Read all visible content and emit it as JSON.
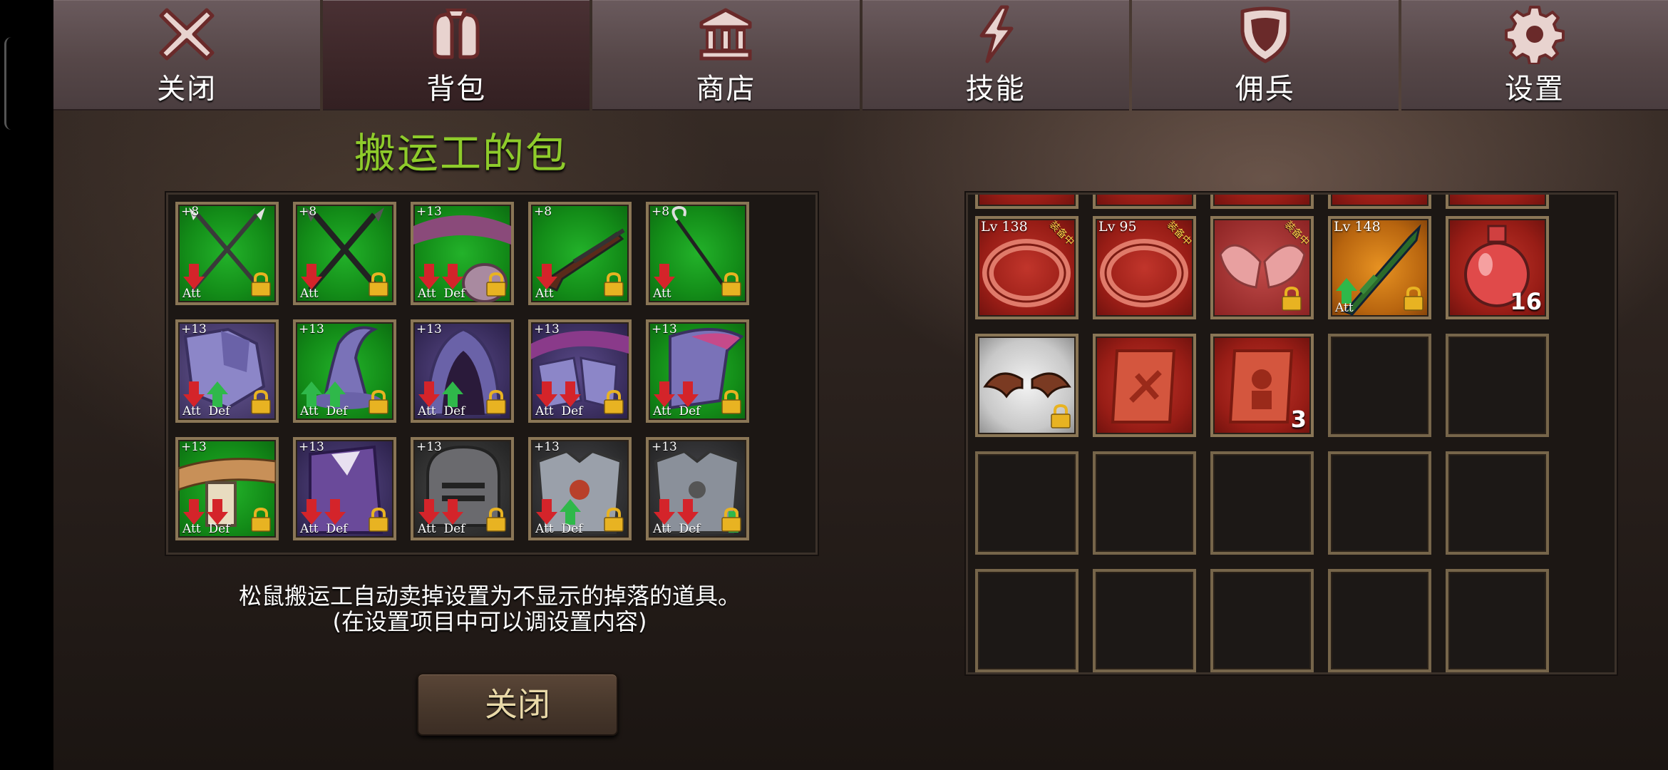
{
  "tabs": [
    {
      "label": "关闭",
      "icon": "close-x-icon"
    },
    {
      "label": "背包",
      "icon": "backpack-icon",
      "active": true
    },
    {
      "label": "商店",
      "icon": "shop-building-icon"
    },
    {
      "label": "技能",
      "icon": "lightning-icon"
    },
    {
      "label": "佣兵",
      "icon": "shield-icon"
    },
    {
      "label": "设置",
      "icon": "gear-icon"
    }
  ],
  "bag": {
    "title": "搬运工的包",
    "items": [
      {
        "level": "+8",
        "stats": "Att",
        "item": "crossed-spears"
      },
      {
        "level": "+8",
        "stats": "Att",
        "item": "crossed-dark-spears"
      },
      {
        "level": "+13",
        "stats": "Att  Def",
        "item": "purple-belt"
      },
      {
        "level": "+8",
        "stats": "Att",
        "item": "rifle"
      },
      {
        "level": "+8",
        "stats": "Att",
        "item": "hook-staff"
      },
      {
        "level": "+13",
        "stats": "Att  Def",
        "item": "purple-armor"
      },
      {
        "level": "+13",
        "stats": "Att  Def",
        "item": "purple-wizard-hat"
      },
      {
        "level": "+13",
        "stats": "Att  Def",
        "item": "purple-hood"
      },
      {
        "level": "+13",
        "stats": "Att  Def",
        "item": "purple-gloves"
      },
      {
        "level": "+13",
        "stats": "Att  Def",
        "item": "purple-boots"
      },
      {
        "level": "+13",
        "stats": "Att  Def",
        "item": "brown-belt"
      },
      {
        "level": "+13",
        "stats": "Att  Def",
        "item": "purple-cloak"
      },
      {
        "level": "+13",
        "stats": "Att  Def",
        "item": "steel-helmet"
      },
      {
        "level": "+13",
        "stats": "Att  Def",
        "item": "steel-armor"
      },
      {
        "level": "+13",
        "stats": "Att  Def",
        "item": "steel-armor-2"
      }
    ]
  },
  "inventory": {
    "items": [
      {
        "lv": "Lv 138",
        "ribbon": "装备中",
        "item": "red-ring"
      },
      {
        "lv": "Lv 95",
        "ribbon": "装备中",
        "item": "red-ring-2"
      },
      {
        "lv": "",
        "ribbon": "装备中",
        "item": "angel-wings"
      },
      {
        "lv": "Lv 148",
        "stats": "Att",
        "item": "green-sword"
      },
      {
        "count": "16",
        "item": "red-potion"
      },
      {
        "item": "bat-wings"
      },
      {
        "item": "red-scroll"
      },
      {
        "count": "3",
        "item": "red-scroll-2"
      }
    ]
  },
  "message": {
    "line1": "松鼠搬运工自动卖掉设置为不显示的掉落的道具。",
    "line2": "(在设置项目中可以调设置内容)"
  },
  "close_button": "关闭",
  "colors": {
    "title_green": "#8ecb2b",
    "down_arrow": "#d4242a",
    "up_arrow": "#2fb84a",
    "lock": "#e8b322"
  }
}
